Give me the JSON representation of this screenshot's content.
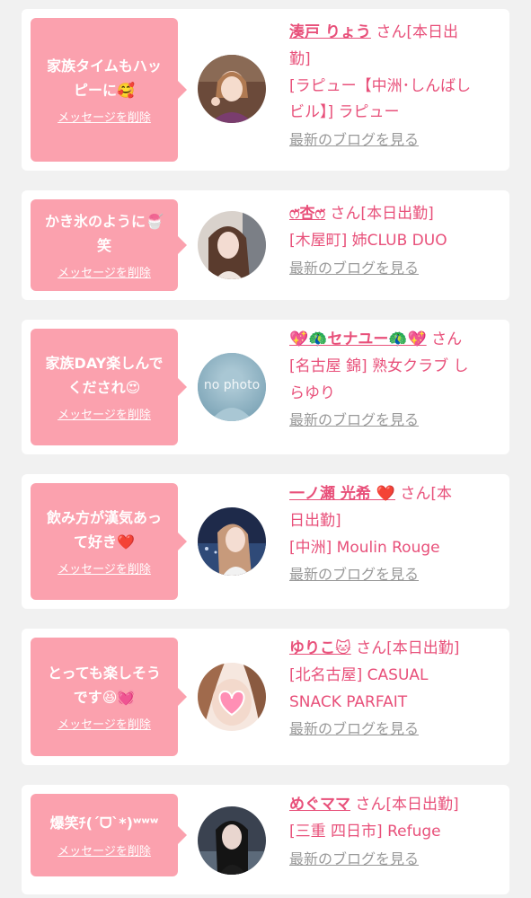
{
  "delete_label": "メッセージを削除",
  "blog_label": "最新のブログを見る",
  "colors": {
    "bubble": "#fba1ae",
    "accent": "#e8507a",
    "link_gray": "#999999"
  },
  "cards": [
    {
      "message_lines": [
        "家族タイムもハッ",
        "ピーに🥰"
      ],
      "name": "湊戸 りょう",
      "line1_suffix": " さん[本日出",
      "line2": "勤]",
      "line3": "[ラピュー【中洲･しんばし",
      "line4": "ビル】] ラピュー"
    },
    {
      "message_lines": [
        "かき氷のように🍧",
        "笑"
      ],
      "name": "ෆ̈杏ෆ̈",
      "line1_suffix": " さん[本日出勤]",
      "line2": "[木屋町] 姉CLUB DUO"
    },
    {
      "message_lines": [
        "家族DAY楽しんで",
        "くだされ😍"
      ],
      "name": "💖🦚セナユー🦚💖",
      "line1_suffix": " さん",
      "line2": "[名古屋 錦] 熟女クラブ し",
      "line3": "らゆり",
      "avatar_text": "no photo"
    },
    {
      "message_lines": [
        "飲み方が漢気あっ",
        "て好き❤️"
      ],
      "name": "一ノ瀬 光希 ❤️",
      "line1_suffix": " さん[本",
      "line2": "日出勤]",
      "line3": "[中洲] Moulin Rouge"
    },
    {
      "message_lines": [
        "とっても楽しそう",
        "です😆💓"
      ],
      "name": "ゆりこ🐱",
      "line1_suffix": " さん[本日出勤]",
      "line2": "[北名古屋] CASUAL",
      "line3": "SNACK PARFAIT"
    },
    {
      "message_lines": [
        "爆笑ﾁ(´ᗜ`*)ʷʷʷ"
      ],
      "name": "めぐママ",
      "line1_suffix": " さん[本日出勤]",
      "line2": "[三重 四日市] Refuge"
    }
  ]
}
